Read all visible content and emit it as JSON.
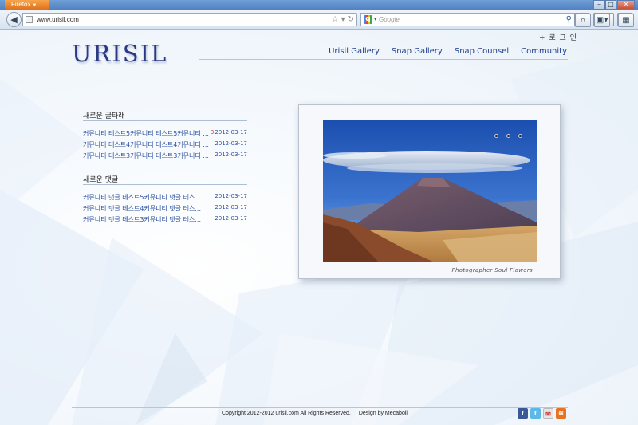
{
  "browser": {
    "app_button": "Firefox",
    "url": "www.urisil.com",
    "search_placeholder": "Google"
  },
  "site": {
    "logo": "URISIL",
    "login": "+ 로 그 인",
    "nav": [
      "Urisil Gallery",
      "Snap Gallery",
      "Snap Counsel",
      "Community"
    ]
  },
  "recent_posts": {
    "heading": "새로운 글타래",
    "items": [
      {
        "title": "커뮤니티 테스트5커뮤니티 테스트5커뮤니티 ...",
        "count": "3",
        "date": "2012-03-17"
      },
      {
        "title": "커뮤니티 테스트4커뮤니티 테스트4커뮤니티 ...",
        "count": "",
        "date": "2012-03-17"
      },
      {
        "title": "커뮤니티 테스트3커뮤니티 테스트3커뮤니티 ...",
        "count": "",
        "date": "2012-03-17"
      }
    ]
  },
  "recent_comments": {
    "heading": "새로운 댓글",
    "items": [
      {
        "title": "커뮤니티 댓글 테스트5커뮤니티 댓글 테스...",
        "date": "2012-03-17"
      },
      {
        "title": "커뮤니티 댓글 테스트4커뮤니티 댓글 테스...",
        "date": "2012-03-17"
      },
      {
        "title": "커뮤니티 댓글 테스트3커뮤니티 댓글 테스...",
        "date": "2012-03-17"
      }
    ]
  },
  "slideshow": {
    "credit": "Photographer Soul Flowers",
    "dots": 3
  },
  "footer": {
    "copyright": "Copyright 2012-2012 urisil.com All Rights Reserved.",
    "design": "Design by Mecaboil",
    "social_icons": [
      "facebook-icon",
      "twitter-icon",
      "mail-icon",
      "rss-icon"
    ]
  },
  "colors": {
    "brand": "#2a3a84",
    "link": "#1f3f8f",
    "accent": "#d33333"
  }
}
